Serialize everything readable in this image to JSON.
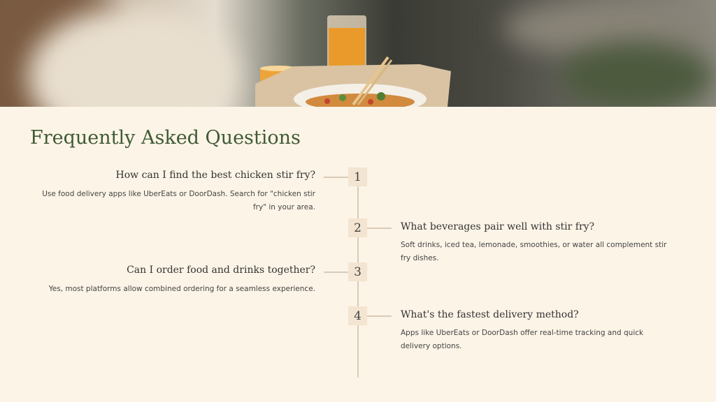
{
  "hero": {
    "image": "photo-woman-with-stir-fry-bowl-and-drinks"
  },
  "title": "Frequently Asked Questions",
  "faqs": [
    {
      "number": "1",
      "question": "How can I find the best chicken stir fry?",
      "answer": "Use food delivery apps like UberEats or DoorDash. Search for \"chicken stir fry\" in your area."
    },
    {
      "number": "2",
      "question": "What beverages pair well with stir fry?",
      "answer": "Soft drinks, iced tea, lemonade, smoothies, or water all complement stir fry dishes."
    },
    {
      "number": "3",
      "question": "Can I order food and drinks together?",
      "answer": "Yes, most platforms allow combined ordering for a seamless experience."
    },
    {
      "number": "4",
      "question": "What's the fastest delivery method?",
      "answer": "Apps like UberEats or DoorDash offer real-time tracking and quick delivery options."
    }
  ],
  "colors": {
    "background": "#fcf4e7",
    "title": "#3f5a35",
    "number_box": "#f3e5d1",
    "timeline": "#d9cbb7"
  }
}
